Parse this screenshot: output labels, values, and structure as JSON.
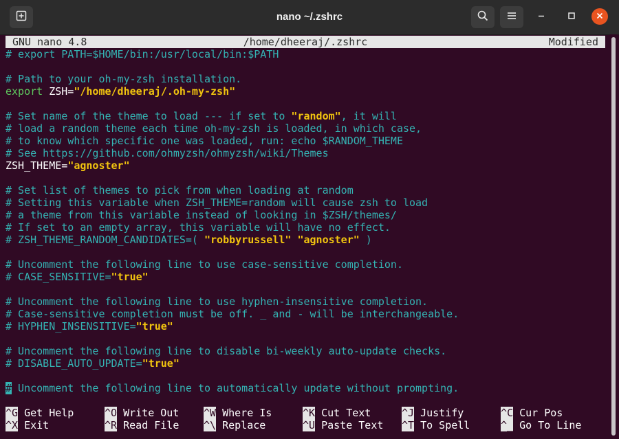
{
  "window": {
    "title": "nano ~/.zshrc"
  },
  "icons": {
    "new_tab": "new-tab-icon",
    "search": "search-icon",
    "menu": "hamburger-menu-icon",
    "minimize": "minimize-icon",
    "maximize": "maximize-icon",
    "close": "close-icon"
  },
  "nano": {
    "version": "GNU nano 4.8",
    "file_path": "/home/dheeraj/.zshrc",
    "status": "Modified"
  },
  "lines": [
    {
      "comment": "# export PATH=$HOME/bin:/usr/local/bin:$PATH"
    },
    {
      "blank": ""
    },
    {
      "comment": "# Path to your oh-my-zsh installation."
    },
    {
      "kw": "export",
      "rest": " ZSH=",
      "str": "\"/home/dheeraj/.oh-my-zsh\""
    },
    {
      "blank": ""
    },
    {
      "comment": "# Set name of the theme to load --- if set to ",
      "str": "\"random\"",
      "after": ", it will"
    },
    {
      "comment": "# load a random theme each time oh-my-zsh is loaded, in which case,"
    },
    {
      "comment": "# to know which specific one was loaded, run: echo $RANDOM_THEME"
    },
    {
      "comment": "# See https://github.com/ohmyzsh/ohmyzsh/wiki/Themes"
    },
    {
      "rest": "ZSH_THEME=",
      "str": "\"agnoster\""
    },
    {
      "blank": ""
    },
    {
      "comment": "# Set list of themes to pick from when loading at random"
    },
    {
      "comment": "# Setting this variable when ZSH_THEME=random will cause zsh to load"
    },
    {
      "comment": "# a theme from this variable instead of looking in $ZSH/themes/"
    },
    {
      "comment": "# If set to an empty array, this variable will have no effect."
    },
    {
      "comment": "# ZSH_THEME_RANDOM_CANDIDATES=( ",
      "str": "\"robbyrussell\" \"agnoster\"",
      "after": " )"
    },
    {
      "blank": ""
    },
    {
      "comment": "# Uncomment the following line to use case-sensitive completion."
    },
    {
      "comment": "# CASE_SENSITIVE=",
      "str": "\"true\""
    },
    {
      "blank": ""
    },
    {
      "comment": "# Uncomment the following line to use hyphen-insensitive completion."
    },
    {
      "comment": "# Case-sensitive completion must be off. _ and - will be interchangeable."
    },
    {
      "comment": "# HYPHEN_INSENSITIVE=",
      "str": "\"true\""
    },
    {
      "blank": ""
    },
    {
      "comment": "# Uncomment the following line to disable bi-weekly auto-update checks."
    },
    {
      "comment": "# DISABLE_AUTO_UPDATE=",
      "str": "\"true\""
    },
    {
      "blank": ""
    },
    {
      "cursor": "#",
      "comment": " Uncomment the following line to automatically update without prompting."
    }
  ],
  "shortcuts": [
    [
      {
        "key": "^G",
        "label": "Get Help"
      },
      {
        "key": "^O",
        "label": "Write Out"
      },
      {
        "key": "^W",
        "label": "Where Is"
      },
      {
        "key": "^K",
        "label": "Cut Text"
      },
      {
        "key": "^J",
        "label": "Justify"
      },
      {
        "key": "^C",
        "label": "Cur Pos"
      }
    ],
    [
      {
        "key": "^X",
        "label": "Exit"
      },
      {
        "key": "^R",
        "label": "Read File"
      },
      {
        "key": "^\\",
        "label": "Replace"
      },
      {
        "key": "^U",
        "label": "Paste Text"
      },
      {
        "key": "^T",
        "label": "To Spell"
      },
      {
        "key": "^_",
        "label": "Go To Line"
      }
    ]
  ],
  "colors": {
    "terminal_bg": "#300a24",
    "comment": "#34b3b3",
    "string": "#f1c40f",
    "keyword": "#5ec85e",
    "close_button": "#e95420"
  }
}
